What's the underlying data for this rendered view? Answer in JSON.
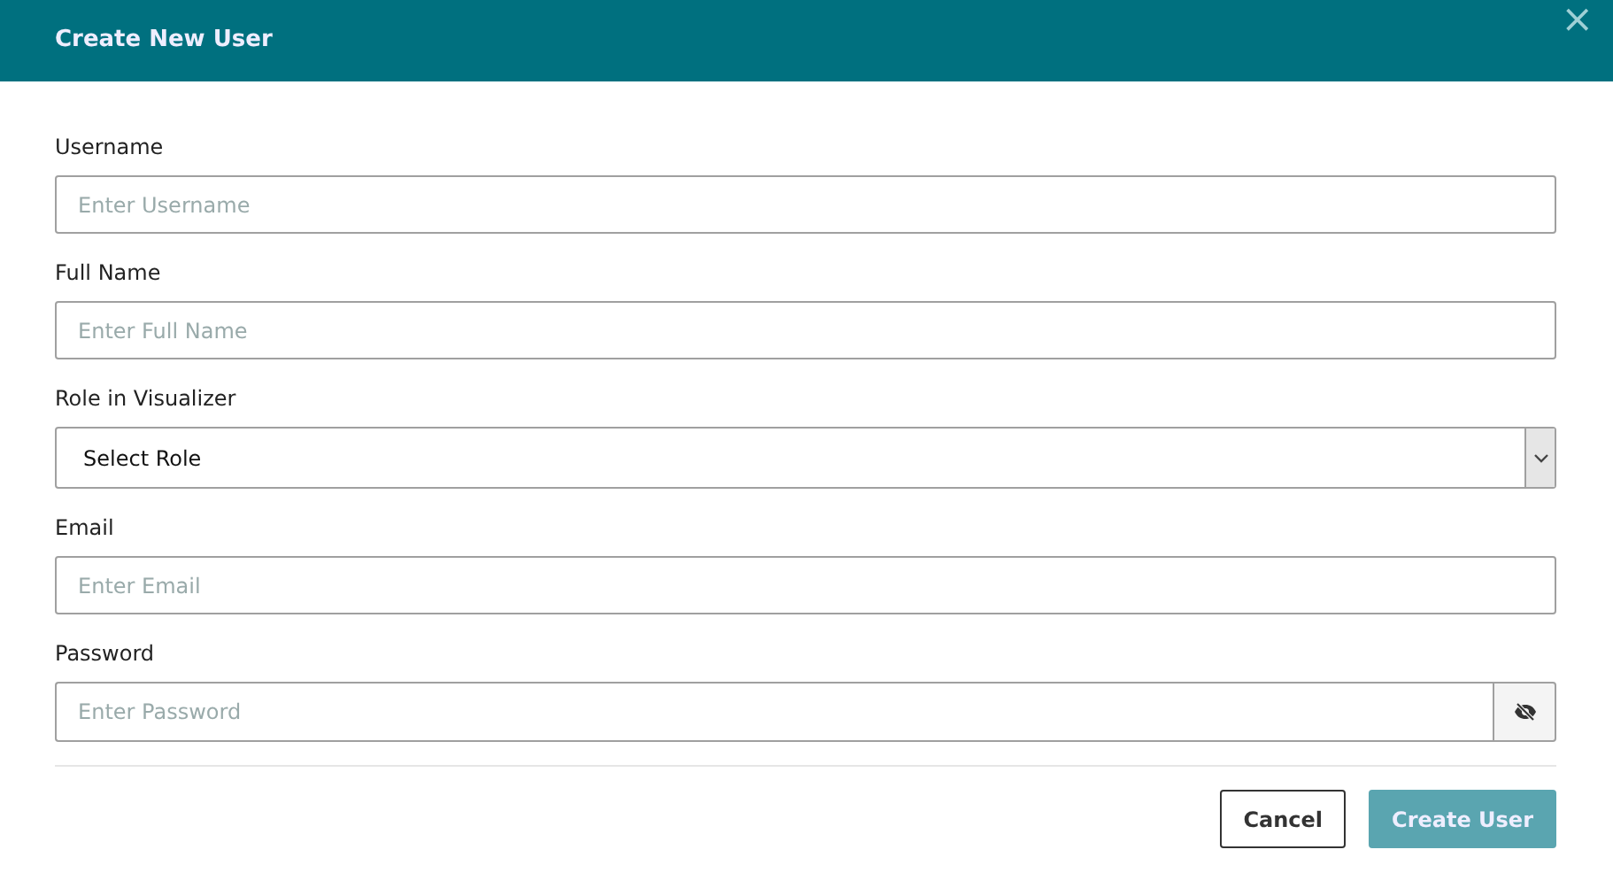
{
  "dialog": {
    "title": "Create New User",
    "close": "×"
  },
  "fields": [
    {
      "kind": "text",
      "label": "Username",
      "placeholder": "Enter Username"
    },
    {
      "kind": "text",
      "label": "Full Name",
      "placeholder": "Enter Full Name"
    },
    {
      "kind": "select",
      "label": "Role in Visualizer",
      "value": "Select Role"
    },
    {
      "kind": "text",
      "label": "Email",
      "placeholder": "Enter Email"
    },
    {
      "kind": "password",
      "label": "Password",
      "placeholder": "Enter Password"
    }
  ],
  "buttons": [
    {
      "label": "Cancel",
      "kind": "secondary",
      "disabled": false
    },
    {
      "label": "Create User",
      "kind": "primary",
      "disabled": true
    }
  ]
}
